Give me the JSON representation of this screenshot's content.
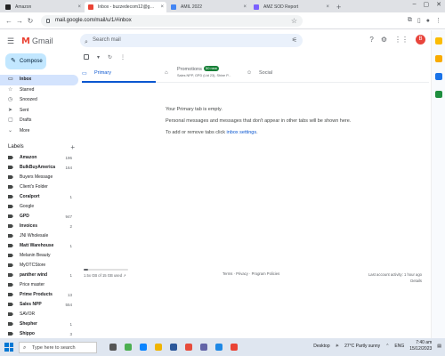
{
  "browser": {
    "tabs": [
      {
        "label": "Amazon",
        "color": "#222222",
        "active": false
      },
      {
        "label": "Inbox - buzzedecom12@gmail.c...",
        "color": "#ea4335",
        "active": true
      },
      {
        "label": "AMIL 2022",
        "color": "#4285f4",
        "active": false
      },
      {
        "label": "AMZ SOD Report",
        "color": "#7b61ff",
        "active": false
      }
    ],
    "new_tab": "+",
    "url": "mail.google.com/mail/u/1/#inbox"
  },
  "gmail": {
    "logo_text": "Gmail",
    "search_placeholder": "Search mail",
    "avatar_initial": "B",
    "compose_label": "Compose",
    "nav": [
      {
        "label": "Inbox",
        "icon": "▭",
        "active": true
      },
      {
        "label": "Starred",
        "icon": "☆",
        "active": false
      },
      {
        "label": "Snoozed",
        "icon": "◷",
        "active": false
      },
      {
        "label": "Sent",
        "icon": "➤",
        "active": false
      },
      {
        "label": "Drafts",
        "icon": "▢",
        "active": false
      },
      {
        "label": "More",
        "icon": "⌄",
        "active": false
      }
    ],
    "labels_title": "Labels",
    "labels": [
      {
        "name": "Amazon",
        "count": "196",
        "bold": true
      },
      {
        "name": "BulkBuyAmerica",
        "count": "164",
        "bold": true
      },
      {
        "name": "Buyers Message",
        "count": "",
        "bold": false
      },
      {
        "name": "Client's Folder",
        "count": "",
        "bold": false
      },
      {
        "name": "Coralport",
        "count": "1",
        "bold": true
      },
      {
        "name": "Google",
        "count": "",
        "bold": false
      },
      {
        "name": "GPD",
        "count": "947",
        "bold": true
      },
      {
        "name": "Invoices",
        "count": "2",
        "bold": true
      },
      {
        "name": "JNI Wholesale",
        "count": "",
        "bold": false
      },
      {
        "name": "Matt Warehouse",
        "count": "1",
        "bold": true
      },
      {
        "name": "Melanin Beauty",
        "count": "",
        "bold": false
      },
      {
        "name": "MyOTCStore",
        "count": "",
        "bold": false
      },
      {
        "name": "panther wind",
        "count": "1",
        "bold": true
      },
      {
        "name": "Price master",
        "count": "",
        "bold": false
      },
      {
        "name": "Prime Products",
        "count": "13",
        "bold": true
      },
      {
        "name": "Sales NPP",
        "count": "554",
        "bold": true
      },
      {
        "name": "SAVOR",
        "count": "",
        "bold": false
      },
      {
        "name": "Shepher",
        "count": "1",
        "bold": true
      },
      {
        "name": "Shippo",
        "count": "3",
        "bold": true
      }
    ],
    "tabs": {
      "primary": "Primary",
      "promotions": "Promotions",
      "promotions_badge": "50 new",
      "promotions_snippet": "Sales NPP, GPD (Ltd 23), Shine P...",
      "social": "Social"
    },
    "empty": {
      "line1": "Your Primary tab is empty.",
      "line2": "Personal messages and messages that don't appear in other tabs will be shown here.",
      "line3_prefix": "To add or remove tabs click ",
      "line3_link": "inbox settings",
      "line3_suffix": "."
    },
    "footer": {
      "storage_text": "1.5x GB of 15 GB used",
      "storage_fraction": 0.1,
      "terms": "Terms · Privacy · Program Policies",
      "activity": "Last account activity: 1 hour ago",
      "details": "Details"
    }
  },
  "taskbar": {
    "search_placeholder": "Type here to search",
    "desktop": "Desktop",
    "weather": "27°C Partly sunny",
    "lang": "ENG",
    "time": "7:40 am",
    "date": "15/12/2023"
  }
}
